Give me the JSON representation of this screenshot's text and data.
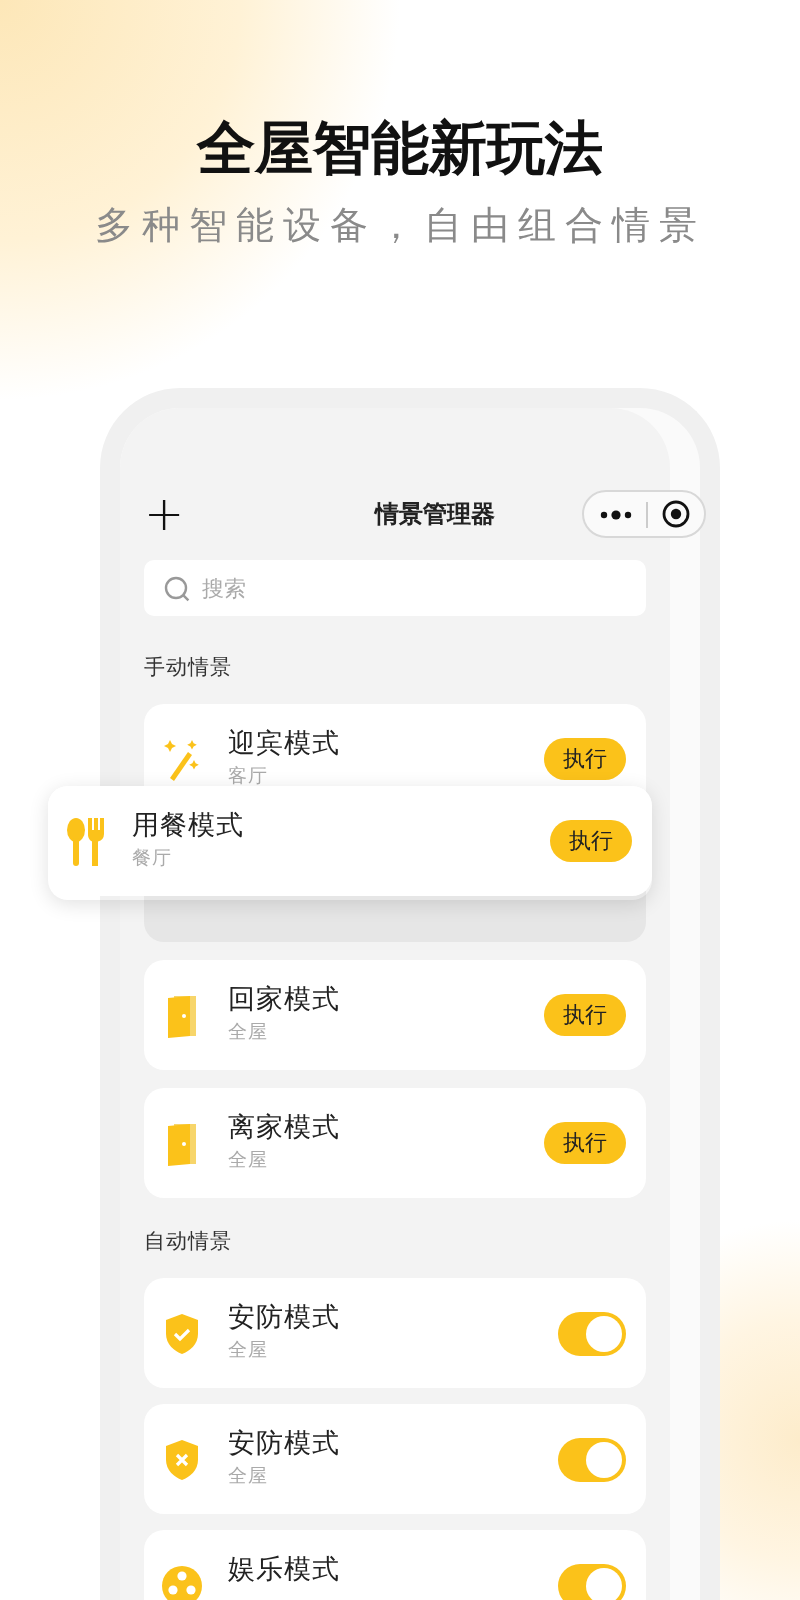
{
  "headline": "全屋智能新玩法",
  "subheadline": "多种智能设备，自由组合情景",
  "app": {
    "add_icon": "+",
    "title": "情景管理器",
    "search": {
      "placeholder": "搜索"
    },
    "sections": [
      {
        "title": "手动情景",
        "scenes": [
          {
            "kind": "action",
            "name": "迎宾模式",
            "room": "客厅",
            "button": "执行"
          },
          {
            "kind": "pressed"
          },
          {
            "kind": "action",
            "name": "回家模式",
            "room": "全屋",
            "button": "执行"
          },
          {
            "kind": "action",
            "name": "离家模式",
            "room": "全屋",
            "button": "执行"
          }
        ]
      },
      {
        "title": "自动情景",
        "scenes": [
          {
            "kind": "toggle",
            "name": "安防模式",
            "room": "全屋",
            "on": true
          },
          {
            "kind": "toggle",
            "name": "安防模式",
            "room": "全屋",
            "on": true
          },
          {
            "kind": "toggle",
            "name": "娱乐模式",
            "on": true
          }
        ]
      }
    ]
  },
  "popup": {
    "name": "用餐模式",
    "room": "餐厅",
    "button": "执行"
  }
}
